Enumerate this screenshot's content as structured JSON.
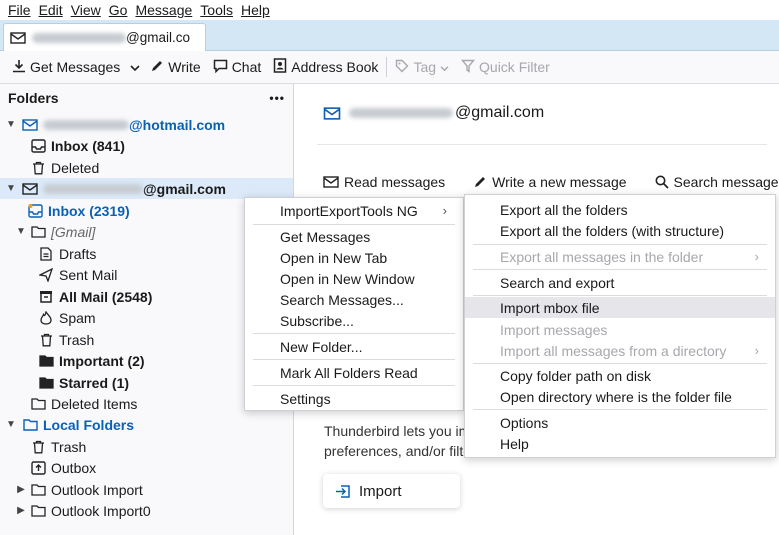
{
  "menubar": [
    "File",
    "Edit",
    "View",
    "Go",
    "Message",
    "Tools",
    "Help"
  ],
  "tab": {
    "suffix": "@gmail.co"
  },
  "toolbar": {
    "get_messages": "Get Messages",
    "write": "Write",
    "chat": "Chat",
    "address_book": "Address Book",
    "tag": "Tag",
    "quick_filter": "Quick Filter"
  },
  "sidebar": {
    "title": "Folders",
    "more": "•••",
    "hotmail_suffix": "@hotmail.com",
    "inbox1": "Inbox (841)",
    "deleted": "Deleted",
    "gmail_suffix": "@gmail.com",
    "inbox2": "Inbox (2319)",
    "gmail_folder": "[Gmail]",
    "drafts": "Drafts",
    "sent": "Sent Mail",
    "allmail": "All Mail (2548)",
    "spam": "Spam",
    "trash": "Trash",
    "important": "Important (2)",
    "starred": "Starred (1)",
    "deleted_items": "Deleted Items",
    "local": "Local Folders",
    "local_trash": "Trash",
    "outbox": "Outbox",
    "outlook_import": "Outlook Import",
    "outlook_import0": "Outlook Import0"
  },
  "main": {
    "account_suffix": "@gmail.com",
    "read": "Read messages",
    "write": "Write a new message",
    "search": "Search messages",
    "para_line1": "Thunderbird lets you im",
    "para_line2": "preferences, and/or filte",
    "import": "Import"
  },
  "context_menu": {
    "importexport": "ImportExportTools NG",
    "get_messages": "Get Messages",
    "open_new_tab": "Open in New Tab",
    "open_new_window": "Open in New Window",
    "search_messages": "Search Messages...",
    "subscribe": "Subscribe...",
    "new_folder": "New Folder...",
    "mark_all_read": "Mark All Folders Read",
    "settings": "Settings"
  },
  "submenu": {
    "export_all": "Export all the folders",
    "export_all_struct": "Export all the folders (with structure)",
    "export_all_msgs": "Export all messages in the folder",
    "search_export": "Search and export",
    "import_mbox": "Import mbox file",
    "import_messages": "Import messages",
    "import_all_dir": "Import all messages from a directory",
    "copy_path": "Copy folder path on disk",
    "open_dir": "Open directory where is the folder file",
    "options": "Options",
    "help": "Help"
  },
  "colors": {
    "accent": "#0b60b5",
    "selected_row": "#dbe9f8",
    "tabstrip": "#d4e7f5",
    "highlight": "#e5e5ea"
  }
}
